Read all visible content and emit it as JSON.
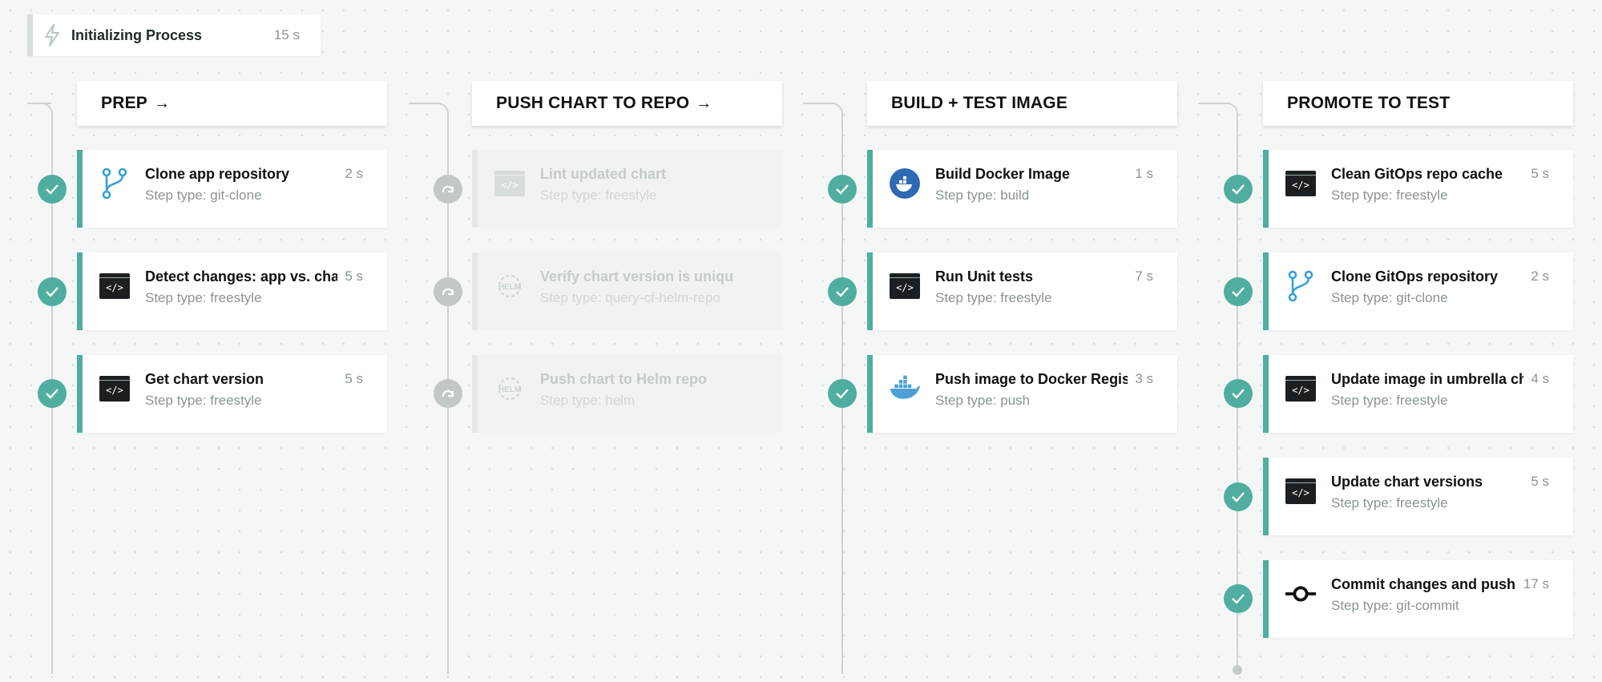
{
  "init": {
    "label": "Initializing Process",
    "duration": "15 s"
  },
  "stages": [
    {
      "title": "PREP",
      "steps": [
        {
          "title": "Clone app repository",
          "type": "Step type: git-clone",
          "duration": "2 s"
        },
        {
          "title": "Detect changes: app vs. chart",
          "type": "Step type: freestyle",
          "duration": "5 s"
        },
        {
          "title": "Get chart version",
          "type": "Step type: freestyle",
          "duration": "5 s"
        }
      ]
    },
    {
      "title": "PUSH CHART TO REPO",
      "steps": [
        {
          "title": "Lint updated chart",
          "type": "Step type: freestyle",
          "duration": ""
        },
        {
          "title": "Verify chart version is unique",
          "type": "Step type: query-cf-helm-repo",
          "duration": ""
        },
        {
          "title": "Push chart to Helm repo",
          "type": "Step type: helm",
          "duration": ""
        }
      ]
    },
    {
      "title": "BUILD + TEST IMAGE",
      "steps": [
        {
          "title": "Build Docker Image",
          "type": "Step type: build",
          "duration": "1 s"
        },
        {
          "title": "Run Unit tests",
          "type": "Step type: freestyle",
          "duration": "7 s"
        },
        {
          "title": "Push image to Docker Registry",
          "type": "Step type: push",
          "duration": "3 s"
        }
      ]
    },
    {
      "title": "PROMOTE TO TEST",
      "steps": [
        {
          "title": "Clean GitOps repo cache",
          "type": "Step type: freestyle",
          "duration": "5 s"
        },
        {
          "title": "Clone GitOps repository",
          "type": "Step type: git-clone",
          "duration": "2 s"
        },
        {
          "title": "Update image in umbrella chart",
          "type": "Step type: freestyle",
          "duration": "4 s"
        },
        {
          "title": "Update chart versions",
          "type": "Step type: freestyle",
          "duration": "5 s"
        },
        {
          "title": "Commit changes and push",
          "type": "Step type: git-commit",
          "duration": "17 s"
        }
      ]
    }
  ],
  "colors": {
    "success": "#4fae9f",
    "skipped": "#c2c8c8",
    "line": "#ccd3d3"
  }
}
